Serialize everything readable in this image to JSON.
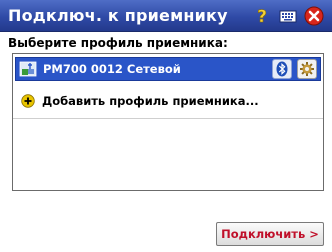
{
  "window": {
    "title": "Подключ. к приемнику",
    "icons": [
      "help-icon",
      "keyboard-icon",
      "close-icon"
    ]
  },
  "prompt": "Выберите профиль приемника:",
  "profiles": [
    {
      "label": "PM700 0012 Сетевой",
      "selected": true,
      "icon": "receiver-icon",
      "actions": [
        "bluetooth-icon",
        "settings-icon"
      ]
    }
  ],
  "add_profile": {
    "label": "Добавить профиль приемника...",
    "icon": "plus-icon"
  },
  "connect_button": {
    "label": "Подключить >"
  },
  "colors": {
    "titlebar": "#2f4aa6",
    "selection": "#2a55c8",
    "connect_text": "#c0102a",
    "close": "#d8261c",
    "plus": "#e8c400"
  }
}
